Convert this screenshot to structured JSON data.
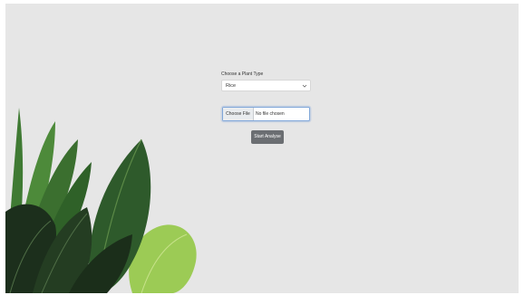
{
  "form": {
    "plant_type_label": "Choose a Plant Type",
    "plant_type_selected": "Rice",
    "file_button_label": "Choose File",
    "file_status": "No file chosen",
    "submit_label": "Start Analyse"
  },
  "decoration": {
    "image": "tropical-leaves",
    "icons": [
      "chevron-down-icon"
    ]
  },
  "colors": {
    "background": "#e6e6e6",
    "button": "#6b6e72",
    "focus_border": "#7fa6d8",
    "leaf_dark": "#1f3b20",
    "leaf_light": "#8fbf4a"
  }
}
